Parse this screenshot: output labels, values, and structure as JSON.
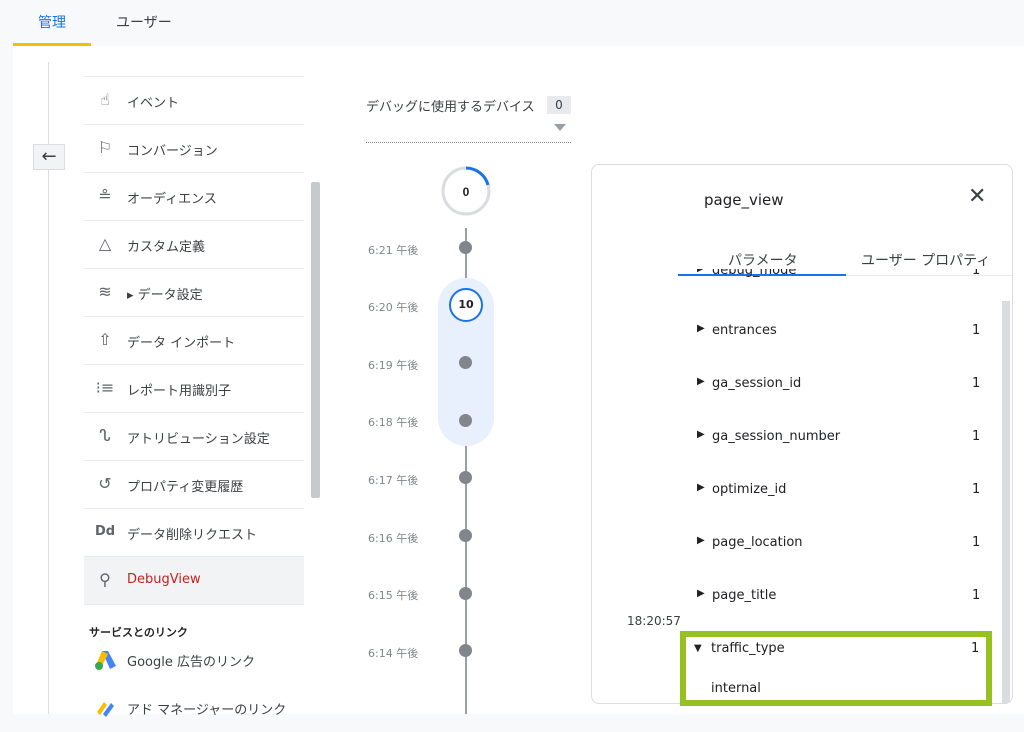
{
  "top_tabs": [
    {
      "label": "管理",
      "active": true
    },
    {
      "label": "ユーザー",
      "active": false
    }
  ],
  "sidebar": {
    "items": [
      {
        "label": "イベント",
        "icon": "touch-icon"
      },
      {
        "label": "コンバージョン",
        "icon": "flag-icon"
      },
      {
        "label": "オーディエンス",
        "icon": "audience-icon"
      },
      {
        "label": "カスタム定義",
        "icon": "shapes-icon"
      },
      {
        "label": "▸ データ設定",
        "icon": "database-icon"
      },
      {
        "label": "データ インポート",
        "icon": "upload-icon"
      },
      {
        "label": "レポート用識別子",
        "icon": "identity-icon"
      },
      {
        "label": "アトリビューション設定",
        "icon": "attribution-icon"
      },
      {
        "label": "プロパティ変更履歴",
        "icon": "history-icon"
      },
      {
        "label": "データ削除リクエスト",
        "icon": "data-deletion-icon"
      },
      {
        "label": "DebugView",
        "icon": "debug-icon",
        "active": true
      }
    ],
    "section_title": "サービスとのリンク",
    "links": [
      {
        "label": "Google 広告のリンク",
        "icon": "google-ads-icon"
      },
      {
        "label": "アド マネージャーのリンク",
        "icon": "ad-manager-icon"
      }
    ]
  },
  "devices": {
    "label": "デバッグに使用するデバイス",
    "count": "0"
  },
  "timeline": {
    "top_count": "0",
    "times": [
      "6:21 午後",
      "6:20 午後",
      "6:19 午後",
      "6:18 午後",
      "6:17 午後",
      "6:16 午後",
      "6:15 午後",
      "6:14 午後"
    ],
    "highlight_count": "10"
  },
  "panel": {
    "title": "page_view",
    "tabs": [
      "パラメータ",
      "ユーザー プロパティ"
    ],
    "partial_param": "debug_mode",
    "params": [
      {
        "name": "entrances",
        "value": "1"
      },
      {
        "name": "ga_session_id",
        "value": "1"
      },
      {
        "name": "ga_session_number",
        "value": "1"
      },
      {
        "name": "optimize_id",
        "value": "1"
      },
      {
        "name": "page_location",
        "value": "1"
      },
      {
        "name": "page_title",
        "value": "1"
      }
    ],
    "expanded_param": {
      "name": "traffic_type",
      "value": "1",
      "detail": "internal"
    },
    "timestamp": "18:20:57"
  },
  "colors": {
    "accent": "#1a73e8",
    "highlight_border": "#97c11f",
    "active_text": "#c5221f"
  }
}
